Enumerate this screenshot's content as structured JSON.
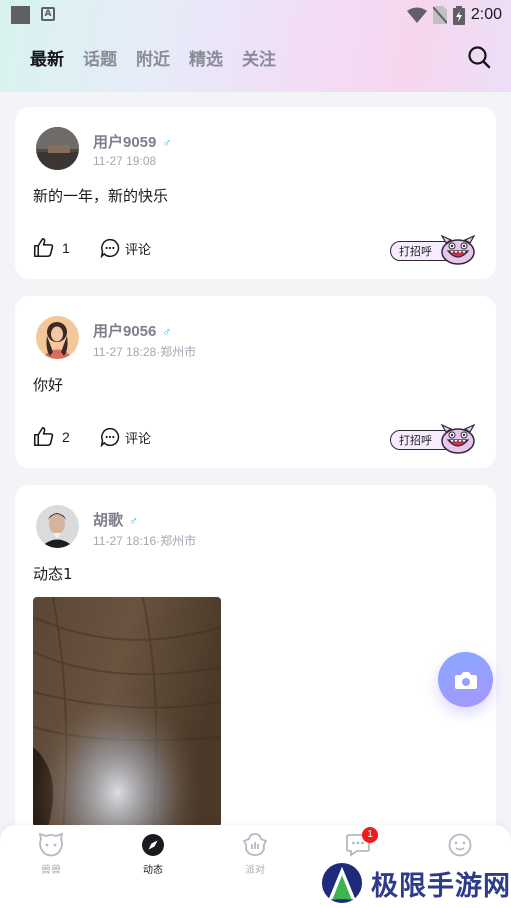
{
  "status_bar": {
    "time": "2:00",
    "a_icon_text": "A"
  },
  "tabs": [
    {
      "label": "最新",
      "active": true
    },
    {
      "label": "话题",
      "active": false
    },
    {
      "label": "附近",
      "active": false
    },
    {
      "label": "精选",
      "active": false
    },
    {
      "label": "关注",
      "active": false
    }
  ],
  "posts": [
    {
      "username": "用户9059",
      "gender": "♂",
      "meta": "11-27 19:08",
      "content": "新的一年，新的快乐",
      "likes": "1",
      "comment_label": "评论",
      "greet_label": "打招呼"
    },
    {
      "username": "用户9056",
      "gender": "♂",
      "meta": "11-27 18:28·郑州市",
      "content": "你好",
      "likes": "2",
      "comment_label": "评论",
      "greet_label": "打招呼"
    },
    {
      "username": "胡歌",
      "gender": "♂",
      "meta": "11-27 18:16·郑州市",
      "content": "动态1"
    }
  ],
  "bottom_nav": [
    {
      "label": "兽兽",
      "icon": "bear-face-icon",
      "active": false
    },
    {
      "label": "动态",
      "icon": "compass-icon",
      "active": true
    },
    {
      "label": "派对",
      "icon": "party-icon",
      "active": false
    },
    {
      "label": "",
      "icon": "message-icon",
      "active": false,
      "badge": "1"
    },
    {
      "label": "",
      "icon": "smile-icon",
      "active": false
    }
  ],
  "watermark": {
    "text": "极限手游网"
  },
  "colors": {
    "accent_blue": "#36b6f2",
    "fab_start": "#86a9ff",
    "fab_end": "#a796ff",
    "badge": "#ee1d1d"
  }
}
